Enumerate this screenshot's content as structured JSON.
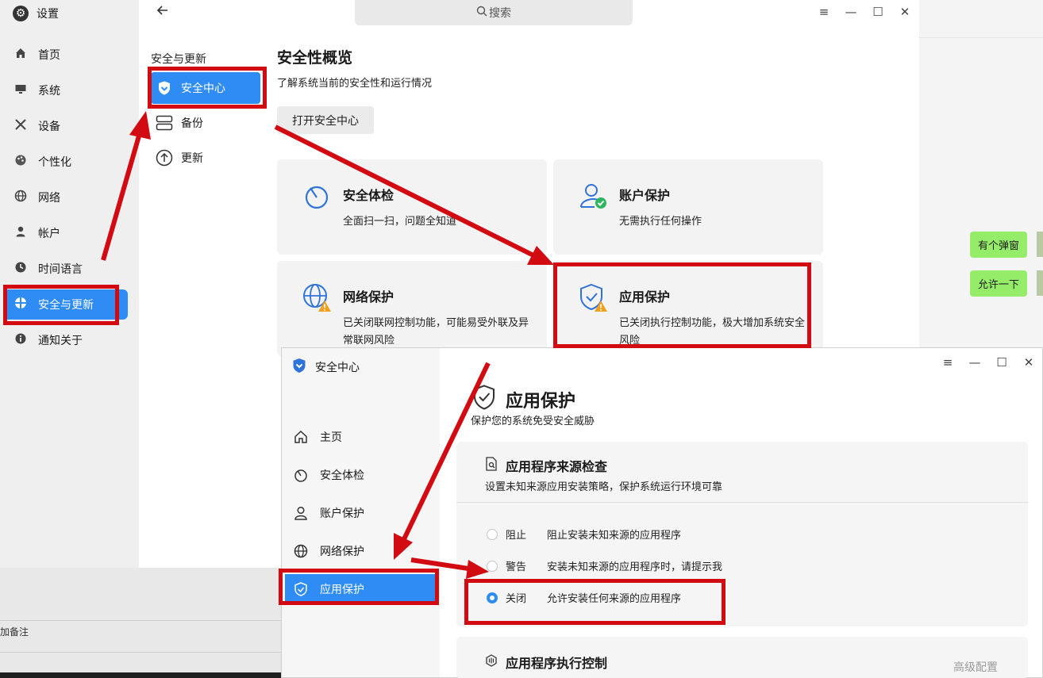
{
  "background": {
    "chat": {
      "bubble_1": "有个弹窗",
      "bubble_2": "允许一下"
    },
    "bottom_fragment": "加备注"
  },
  "settings": {
    "app_title": "设置",
    "search_placeholder": "搜索",
    "nav": [
      {
        "label": "首页",
        "icon": "home-icon"
      },
      {
        "label": "系统",
        "icon": "monitor-icon"
      },
      {
        "label": "设备",
        "icon": "tools-icon"
      },
      {
        "label": "个性化",
        "icon": "palette-icon"
      },
      {
        "label": "网络",
        "icon": "globe-icon"
      },
      {
        "label": "帐户",
        "icon": "user-icon"
      },
      {
        "label": "时间语言",
        "icon": "clock-icon"
      },
      {
        "label": "安全与更新",
        "icon": "shield-icon",
        "active": true
      },
      {
        "label": "通知关于",
        "icon": "info-icon"
      }
    ],
    "sub": {
      "heading": "安全与更新",
      "items": [
        {
          "label": "安全中心",
          "icon": "shield-icon",
          "active": true
        },
        {
          "label": "备份",
          "icon": "backup-icon"
        },
        {
          "label": "更新",
          "icon": "update-icon"
        }
      ]
    },
    "overview": {
      "title": "安全性概览",
      "subtitle": "了解系统当前的安全性和运行情况",
      "open_button": "打开安全中心",
      "cards": [
        {
          "title": "安全体检",
          "desc": "全面扫一扫，问题全知道",
          "icon": "scan-icon"
        },
        {
          "title": "账户保护",
          "desc": "无需执行任何操作",
          "icon": "account-check-icon"
        },
        {
          "title": "网络保护",
          "desc": "已关闭联网控制功能，可能易受外联及异常联网风险",
          "icon": "globe-warning-icon"
        },
        {
          "title": "应用保护",
          "desc": "已关闭执行控制功能，极大增加系统安全风险",
          "icon": "shield-warning-icon"
        }
      ]
    }
  },
  "security_center": {
    "app_title": "安全中心",
    "nav": [
      {
        "label": "主页",
        "icon": "home-icon"
      },
      {
        "label": "安全体检",
        "icon": "scan-icon"
      },
      {
        "label": "账户保护",
        "icon": "user-icon"
      },
      {
        "label": "网络保护",
        "icon": "globe-icon"
      },
      {
        "label": "应用保护",
        "icon": "shield-icon",
        "active": true
      }
    ],
    "page_title": "应用保护",
    "page_subtitle": "保护您的系统免受安全威胁",
    "source_check": {
      "title": "应用程序来源检查",
      "desc": "设置未知来源应用安装策略，保护系统运行环境可靠",
      "options": [
        {
          "label": "阻止",
          "desc": "阻止安装未知来源的应用程序",
          "selected": false
        },
        {
          "label": "警告",
          "desc": "安装未知来源的应用程序时，请提示我",
          "selected": false
        },
        {
          "label": "关闭",
          "desc": "允许安装任何来源的应用程序",
          "selected": true
        }
      ]
    },
    "exec_control": {
      "title": "应用程序执行控制",
      "advanced_link": "高级配置"
    }
  },
  "colors": {
    "accent": "#2f8cf5",
    "annotation": "#d20a11",
    "warning": "#f0a020",
    "success": "#2db55d"
  }
}
